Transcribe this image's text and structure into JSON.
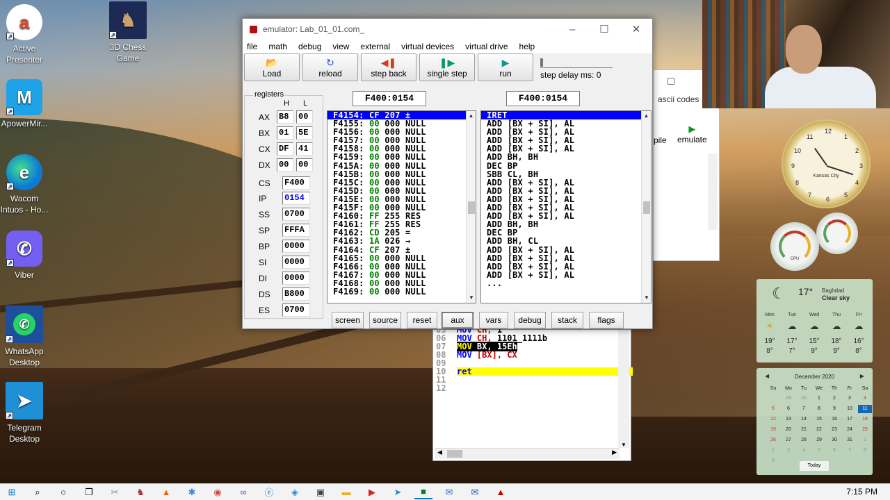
{
  "desktop": {
    "icons": [
      {
        "label": "Active\nPresenter"
      },
      {
        "label": "3D Chess\nGame"
      },
      {
        "label": "ApowerMir..."
      },
      {
        "label": "Wacom\nIntuos - Ho..."
      },
      {
        "label": "Viber"
      },
      {
        "label": "WhatsApp\nDesktop"
      },
      {
        "label": "Telegram\nDesktop"
      }
    ]
  },
  "emulator": {
    "title": "emulator: Lab_01_01.com_",
    "menu": [
      "file",
      "math",
      "debug",
      "view",
      "external",
      "virtual devices",
      "virtual drive",
      "help"
    ],
    "toolbar": {
      "load": "Load",
      "reload": "reload",
      "step_back": "step back",
      "single_step": "single step",
      "run": "run",
      "step_delay": "step delay ms: 0"
    },
    "registers": {
      "legend": "registers",
      "h": "H",
      "l": "L",
      "pairs": [
        {
          "name": "AX",
          "h": "B8",
          "l": "00"
        },
        {
          "name": "BX",
          "h": "01",
          "l": "5E"
        },
        {
          "name": "CX",
          "h": "DF",
          "l": "41"
        },
        {
          "name": "DX",
          "h": "00",
          "l": "00"
        }
      ],
      "singles": [
        {
          "name": "CS",
          "value": "F400"
        },
        {
          "name": "IP",
          "value": "0154"
        },
        {
          "name": "SS",
          "value": "0700"
        },
        {
          "name": "SP",
          "value": "FFFA"
        },
        {
          "name": "BP",
          "value": "0000"
        },
        {
          "name": "SI",
          "value": "0000"
        },
        {
          "name": "DI",
          "value": "0000"
        },
        {
          "name": "DS",
          "value": "B800"
        },
        {
          "name": "ES",
          "value": "0700"
        }
      ],
      "ip_color": "#0000ff"
    },
    "memory_address": "F400:0154",
    "disasm_address": "F400:0154",
    "memory_rows": [
      {
        "addr": "F4154:",
        "hex": "CF",
        "dec": "207",
        "ch": "±"
      },
      {
        "addr": "F4155:",
        "hex": "00",
        "dec": "000",
        "ch": "NULL"
      },
      {
        "addr": "F4156:",
        "hex": "00",
        "dec": "000",
        "ch": "NULL"
      },
      {
        "addr": "F4157:",
        "hex": "00",
        "dec": "000",
        "ch": "NULL"
      },
      {
        "addr": "F4158:",
        "hex": "00",
        "dec": "000",
        "ch": "NULL"
      },
      {
        "addr": "F4159:",
        "hex": "00",
        "dec": "000",
        "ch": "NULL"
      },
      {
        "addr": "F415A:",
        "hex": "00",
        "dec": "000",
        "ch": "NULL"
      },
      {
        "addr": "F415B:",
        "hex": "00",
        "dec": "000",
        "ch": "NULL"
      },
      {
        "addr": "F415C:",
        "hex": "00",
        "dec": "000",
        "ch": "NULL"
      },
      {
        "addr": "F415D:",
        "hex": "00",
        "dec": "000",
        "ch": "NULL"
      },
      {
        "addr": "F415E:",
        "hex": "00",
        "dec": "000",
        "ch": "NULL"
      },
      {
        "addr": "F415F:",
        "hex": "00",
        "dec": "000",
        "ch": "NULL"
      },
      {
        "addr": "F4160:",
        "hex": "FF",
        "dec": "255",
        "ch": "RES"
      },
      {
        "addr": "F4161:",
        "hex": "FF",
        "dec": "255",
        "ch": "RES"
      },
      {
        "addr": "F4162:",
        "hex": "CD",
        "dec": "205",
        "ch": "="
      },
      {
        "addr": "F4163:",
        "hex": "1A",
        "dec": "026",
        "ch": "→"
      },
      {
        "addr": "F4164:",
        "hex": "CF",
        "dec": "207",
        "ch": "±"
      },
      {
        "addr": "F4165:",
        "hex": "00",
        "dec": "000",
        "ch": "NULL"
      },
      {
        "addr": "F4166:",
        "hex": "00",
        "dec": "000",
        "ch": "NULL"
      },
      {
        "addr": "F4167:",
        "hex": "00",
        "dec": "000",
        "ch": "NULL"
      },
      {
        "addr": "F4168:",
        "hex": "00",
        "dec": "000",
        "ch": "NULL"
      },
      {
        "addr": "F4169:",
        "hex": "00",
        "dec": "000",
        "ch": "NULL"
      }
    ],
    "disasm_rows": [
      "IRET",
      "ADD [BX + SI], AL",
      "ADD [BX + SI], AL",
      "ADD [BX + SI], AL",
      "ADD [BX + SI], AL",
      "ADD BH, BH",
      "DEC BP",
      "SBB CL, BH",
      "ADD [BX + SI], AL",
      "ADD [BX + SI], AL",
      "ADD [BX + SI], AL",
      "ADD [BX + SI], AL",
      "ADD [BX + SI], AL",
      "ADD BH, BH",
      "DEC BP",
      "ADD BH, CL",
      "ADD [BX + SI], AL",
      "ADD [BX + SI], AL",
      "ADD [BX + SI], AL",
      "ADD [BX + SI], AL",
      "..."
    ],
    "bottom_buttons": [
      "screen",
      "source",
      "reset",
      "aux",
      "vars",
      "debug",
      "stack",
      "flags"
    ]
  },
  "source": {
    "lines": [
      {
        "n": "05",
        "kw": "MOV",
        "rest": "CH, ",
        "val": "1"
      },
      {
        "n": "06",
        "kw": "MOV",
        "reg": "CH,",
        "val": "1101_1111b"
      },
      {
        "n": "07",
        "kw": "MOV",
        "reg": "BX,",
        "val": "15Eh"
      },
      {
        "n": "08",
        "kw": "MOV",
        "reg": "[BX],",
        "val": "CX"
      },
      {
        "n": "09",
        "kw": "",
        "reg": "",
        "val": ""
      },
      {
        "n": "10",
        "kw": "ret",
        "reg": "",
        "val": ""
      },
      {
        "n": "11",
        "kw": "",
        "reg": "",
        "val": ""
      },
      {
        "n": "12",
        "kw": "",
        "reg": "",
        "val": ""
      }
    ]
  },
  "editor": {
    "ascii_codes": "ascii codes",
    "compile": "pile",
    "emulate": "emulate"
  },
  "gadgets": {
    "clock_city": "Kansas City",
    "clock_numbers": [
      "12",
      "1",
      "2",
      "3",
      "4",
      "5",
      "6",
      "7",
      "8",
      "9",
      "10",
      "11"
    ],
    "cpu_label": "CPU",
    "weather": {
      "temp": "17°",
      "city": "Baghdad",
      "condition": "Clear sky",
      "days": [
        {
          "d": "Mon",
          "hi": "19°",
          "lo": "8°"
        },
        {
          "d": "Tue",
          "hi": "17°",
          "lo": "7°"
        },
        {
          "d": "Wed",
          "hi": "15°",
          "lo": "9°"
        },
        {
          "d": "Thu",
          "hi": "18°",
          "lo": "9°"
        },
        {
          "d": "Fri",
          "hi": "16°",
          "lo": "8°"
        }
      ]
    },
    "calendar": {
      "month": "December 2020",
      "weekdays": [
        "Su",
        "Mo",
        "Tu",
        "We",
        "Th",
        "Fr",
        "Sa"
      ],
      "days": [
        "29",
        "30",
        "1",
        "2",
        "3",
        "4",
        "5",
        "6",
        "7",
        "8",
        "9",
        "10",
        "11",
        "12",
        "13",
        "14",
        "15",
        "16",
        "17",
        "18",
        "19",
        "20",
        "21",
        "22",
        "23",
        "24",
        "25",
        "26",
        "27",
        "28",
        "29",
        "30",
        "31",
        "1",
        "2",
        "3",
        "4",
        "5",
        "6",
        "7",
        "8",
        "9"
      ],
      "today": "Today"
    }
  },
  "taskbar": {
    "time": "7:15 PM"
  }
}
